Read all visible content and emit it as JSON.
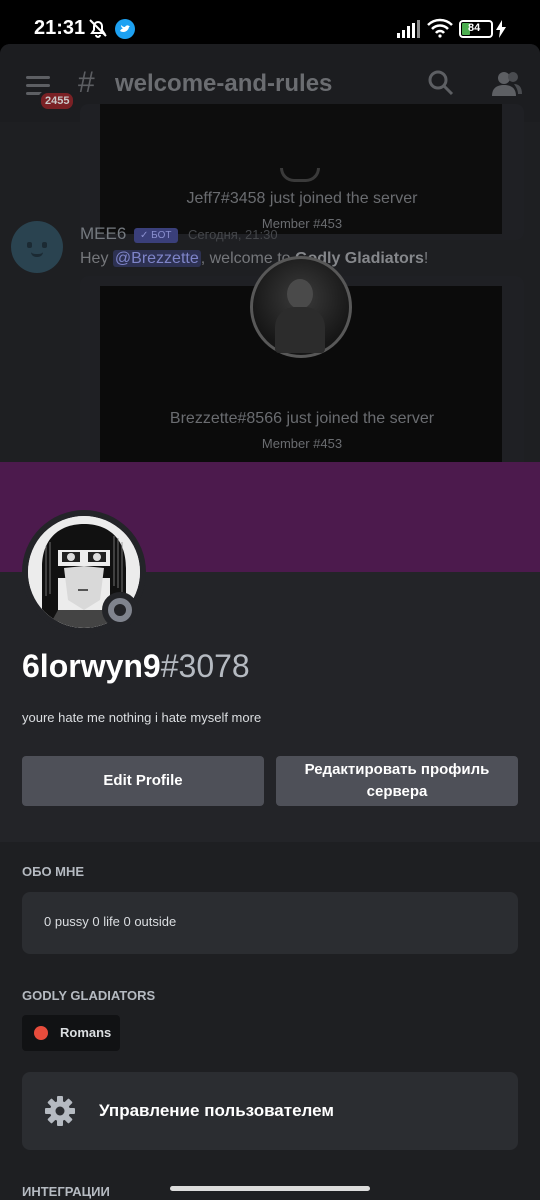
{
  "status_bar": {
    "time": "21:31",
    "battery": "84",
    "icons": [
      "mute-icon",
      "twitter-icon",
      "signal-icon",
      "wifi-icon",
      "battery-icon",
      "charging-icon"
    ]
  },
  "chat": {
    "channel": "welcome-and-rules",
    "unread_badge": "2455",
    "embed1": {
      "text": "Jeff7#3458 just joined the server",
      "member": "Member #453"
    },
    "message": {
      "author": "MEE6",
      "bot_tag": "✓ БОТ",
      "time": "Сегодня, 21:30",
      "greeting": "Hey ",
      "mention": "@Brezzette",
      "mid": ", welcome to ",
      "server": "Godly Gladiators",
      "end": "!"
    },
    "embed2": {
      "text": "Brezzette#8566 just joined the server",
      "member": "Member #453"
    }
  },
  "profile": {
    "banner_color": "#4c1a4d",
    "username": "6lorwyn9",
    "discriminator": "#3078",
    "bio": "youre hate me nothing i hate myself more",
    "edit_profile": "Edit Profile",
    "edit_server_profile": "Редактировать профиль сервера",
    "status": "offline"
  },
  "about": {
    "label": "ОБО МНЕ",
    "text": "0 pussy 0 life 0 outside"
  },
  "server": {
    "label": "GODLY GLADIATORS",
    "role": "Romans",
    "role_color": "#e74c3c"
  },
  "manage": {
    "icon": "gear-icon",
    "label": "Управление пользователем"
  },
  "integrations": {
    "label": "ИНТЕГРАЦИИ"
  }
}
